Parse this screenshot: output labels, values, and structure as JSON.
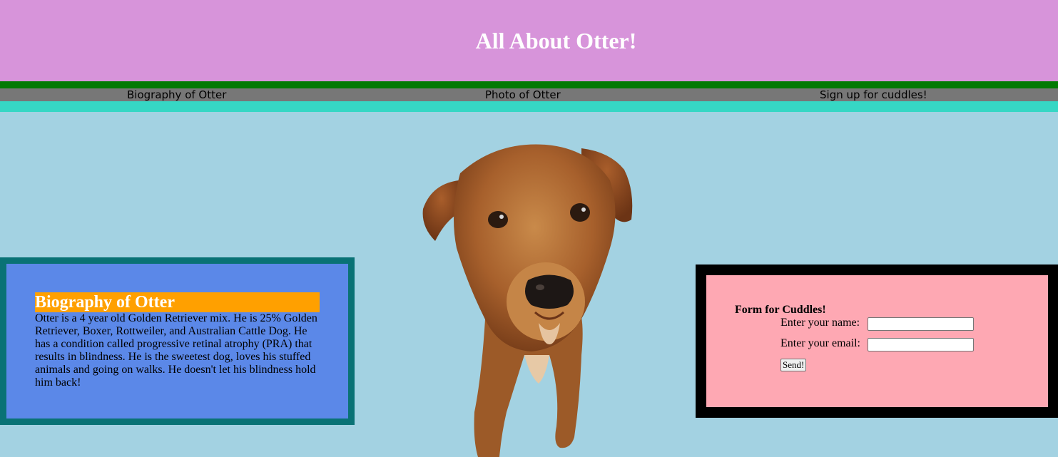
{
  "header": {
    "title": "All About Otter!"
  },
  "nav": {
    "items": [
      {
        "label": "Biography of Otter"
      },
      {
        "label": "Photo of Otter"
      },
      {
        "label": "Sign up for cuddles!"
      }
    ]
  },
  "bio": {
    "heading": "Biography of Otter",
    "text": "Otter is a 4 year old Golden Retriever mix. He is 25% Golden Retriever, Boxer, Rottweiler, and Australian Cattle Dog. He has a condition called progressive retinal atrophy (PRA) that results in blindness. He is the sweetest dog, loves his stuffed animals and going on walks. He doesn't let his blindness hold him back!"
  },
  "photo": {
    "subject": "dog-photo"
  },
  "form": {
    "title": "Form for Cuddles!",
    "name_label": "Enter your name:",
    "name_value": "",
    "email_label": "Enter your email:",
    "email_value": "",
    "submit_label": "Send!"
  },
  "colors": {
    "header_bg": "#d794da",
    "nav_top_band": "#037a04",
    "nav_bar": "#777777",
    "nav_bottom_band": "#36d7c4",
    "page_bg": "#a3d2e2",
    "bio_border": "#097275",
    "bio_bg": "#5b88e8",
    "bio_heading_bg": "#ffa000",
    "form_border": "#000000",
    "form_bg": "#fea8b3"
  }
}
